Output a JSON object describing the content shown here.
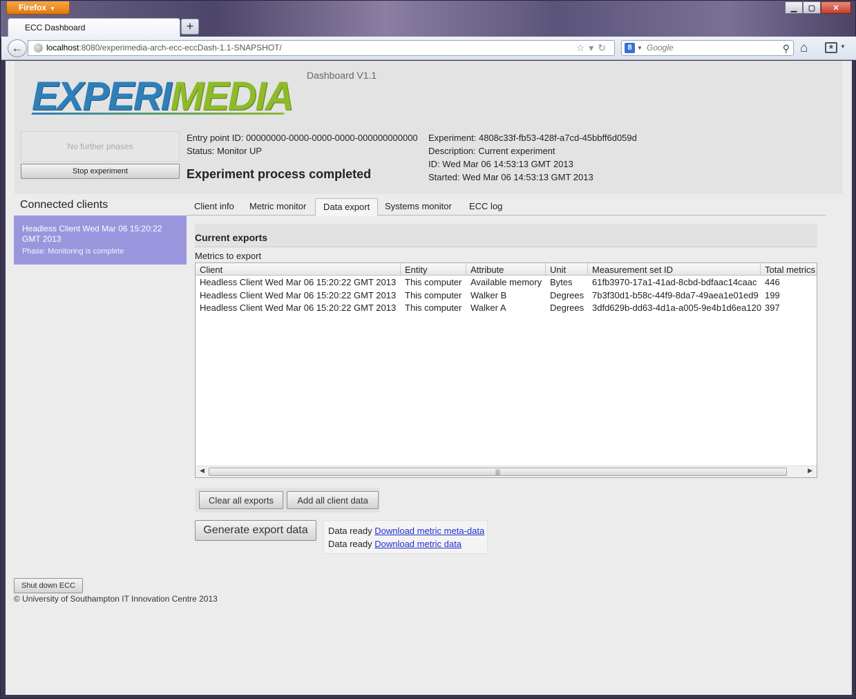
{
  "browser": {
    "menu_label": "Firefox",
    "tab_title": "ECC Dashboard",
    "url_host": "localhost",
    "url_path": ":8080/experimedia-arch-ecc-eccDash-1.1-SNAPSHOT/",
    "search_placeholder": "Google"
  },
  "header": {
    "logo_text_a": "EXPERI",
    "logo_text_b": "MEDIA",
    "version": "Dashboard V1.1",
    "phase_button": "No further phases",
    "stop_button": "Stop experiment",
    "entry_point": "Entry point ID: 00000000-0000-0000-0000-000000000000",
    "status": "Status: Monitor UP",
    "process_status": "Experiment process completed",
    "experiment": "Experiment: 4808c33f-fb53-428f-a7cd-45bbff6d059d",
    "description": "Description: Current experiment",
    "id": "ID: Wed Mar 06 14:53:13 GMT 2013",
    "started": "Started: Wed Mar 06 14:53:13 GMT 2013"
  },
  "clients": {
    "title": "Connected clients",
    "items": [
      {
        "name": "Headless Client Wed Mar 06 15:20:22 GMT 2013",
        "phase": "Phase: Monitoring is complete"
      }
    ]
  },
  "tabs": [
    "Client info",
    "Metric monitor",
    "Data export",
    "Systems monitor",
    "ECC log"
  ],
  "exports": {
    "title": "Current exports",
    "metrics_label": "Metrics to export",
    "columns": [
      "Client",
      "Entity",
      "Attribute",
      "Unit",
      "Measurement set ID",
      "Total metrics"
    ],
    "rows": [
      [
        "Headless Client Wed Mar 06 15:20:22 GMT 2013",
        "This computer",
        "Available memory",
        "Bytes",
        "61fb3970-17a1-41ad-8cbd-bdfaac14caac",
        "446"
      ],
      [
        "Headless Client Wed Mar 06 15:20:22 GMT 2013",
        "This computer",
        "Walker B",
        "Degrees",
        "7b3f30d1-b58c-44f9-8da7-49aea1e01ed9",
        "199"
      ],
      [
        "Headless Client Wed Mar 06 15:20:22 GMT 2013",
        "This computer",
        "Walker A",
        "Degrees",
        "3dfd629b-dd63-4d1a-a005-9e4b1d6ea120",
        "397"
      ]
    ],
    "clear_button": "Clear all exports",
    "add_button": "Add all client data",
    "generate_button": "Generate export data",
    "ready_label": "Data ready",
    "download_meta": "Download metric meta-data",
    "download_data": "Download metric data"
  },
  "footer": {
    "shutdown_button": "Shut down ECC",
    "copyright": "© University of Southampton IT Innovation Centre 2013"
  }
}
